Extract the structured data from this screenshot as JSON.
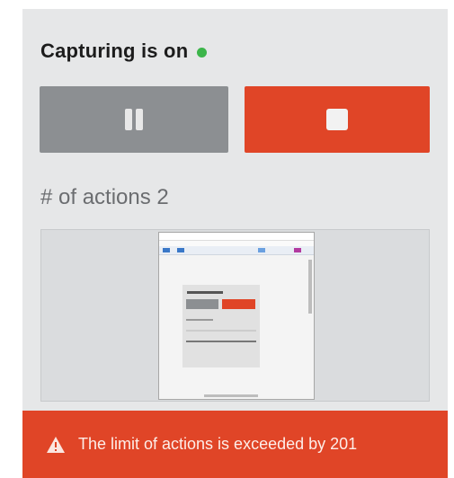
{
  "header": {
    "title": "Capturing is on",
    "status_color": "#3cb54a"
  },
  "controls": {
    "pause_icon": "pause-icon",
    "stop_icon": "stop-icon",
    "pause_color": "#8c8f92",
    "stop_color": "#e04527"
  },
  "actions": {
    "label": "# of actions 2"
  },
  "preview": {
    "icon": "screenshot-thumbnail"
  },
  "warning": {
    "icon": "warning-icon",
    "text": "The limit of actions is exceeded by 201",
    "color": "#e04527"
  }
}
